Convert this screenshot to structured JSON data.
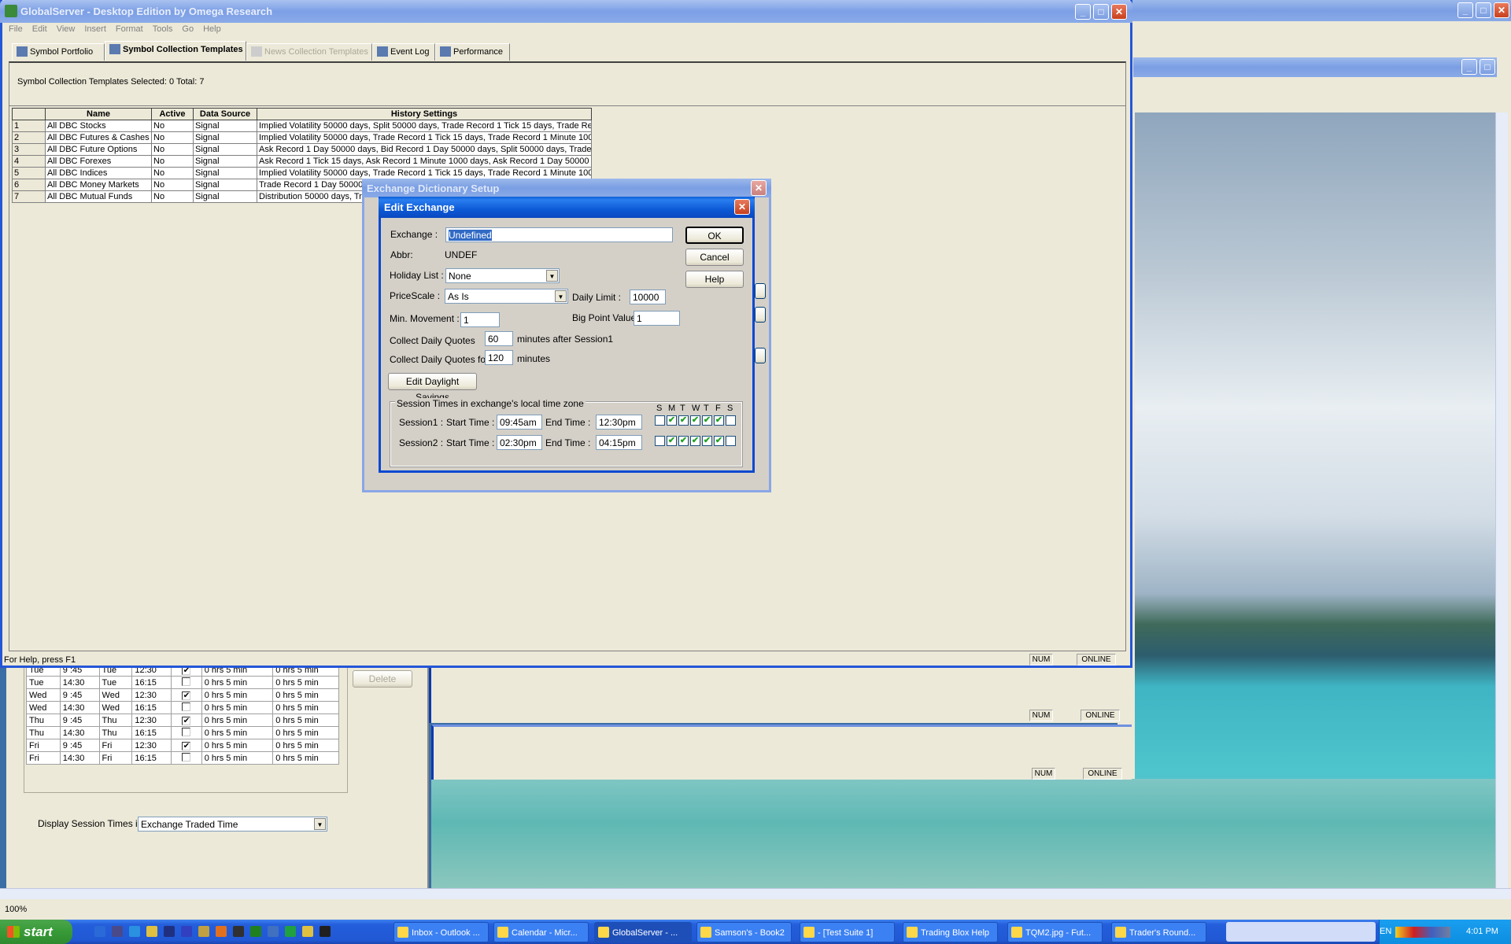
{
  "main_window": {
    "title": "GlobalServer - Desktop Edition by Omega Research",
    "menu": [
      "File",
      "Edit",
      "View",
      "Insert",
      "Format",
      "Tools",
      "Go",
      "Help"
    ],
    "tabs": [
      {
        "label": "Symbol Portfolio",
        "state": "normal"
      },
      {
        "label": "Symbol Collection Templates",
        "state": "active"
      },
      {
        "label": "News Collection Templates",
        "state": "disabled"
      },
      {
        "label": "Event Log",
        "state": "normal"
      },
      {
        "label": "Performance",
        "state": "normal"
      }
    ],
    "summary": "Symbol Collection Templates  Selected: 0   Total: 7",
    "table": {
      "columns": [
        "",
        "Name",
        "Active",
        "Data Source",
        "History Settings"
      ],
      "rows": [
        [
          "1",
          "All DBC Stocks",
          "No",
          "Signal",
          "Implied Volatility 50000 days, Split 50000 days, Trade Record 1 Tick 15 days, Trade Rec"
        ],
        [
          "2",
          "All DBC Futures & Cashes",
          "No",
          "Signal",
          "Implied Volatility 50000 days, Trade Record 1 Tick 15 days, Trade Record 1 Minute 1000"
        ],
        [
          "3",
          "All DBC Future Options",
          "No",
          "Signal",
          "Ask Record 1 Day 50000 days, Bid Record 1 Day 50000 days, Split 50000 days, Trade"
        ],
        [
          "4",
          "All DBC Forexes",
          "No",
          "Signal",
          "Ask Record 1 Tick 15 days, Ask Record 1 Minute 1000 days, Ask Record 1 Day 50000"
        ],
        [
          "5",
          "All DBC Indices",
          "No",
          "Signal",
          "Implied Volatility 50000 days, Trade Record 1 Tick 15 days, Trade Record 1 Minute 1000"
        ],
        [
          "6",
          "All DBC Money Markets",
          "No",
          "Signal",
          "Trade Record 1 Day 50000"
        ],
        [
          "7",
          "All DBC Mutual Funds",
          "No",
          "Signal",
          "Distribution 50000 days, Trad"
        ]
      ]
    },
    "status": {
      "help": "For Help, press F1",
      "num": "NUM",
      "online": "ONLINE"
    }
  },
  "dict_dialog": {
    "title": "Exchange Dictionary Setup"
  },
  "edit_dialog": {
    "title": "Edit Exchange",
    "exchange_label": "Exchange :",
    "exchange_value": "Undefined",
    "abbr_label": "Abbr:",
    "abbr_value": "UNDEF",
    "holiday_label": "Holiday List :",
    "holiday_value": "None",
    "pricescale_label": "PriceScale :",
    "pricescale_value": "As Is",
    "daily_limit_label": "Daily Limit :",
    "daily_limit_value": "10000",
    "min_move_label": "Min. Movement :",
    "min_move_value": "1",
    "bpv_label": "Big Point Value:",
    "bpv_value": "1",
    "cdq_label": "Collect Daily Quotes",
    "cdq_value": "60",
    "cdq_suffix": "minutes after Session1",
    "cdqf_label": "Collect Daily Quotes for",
    "cdqf_value": "120",
    "cdqf_suffix": "minutes",
    "dst_button": "Edit Daylight Savings",
    "ok": "OK",
    "cancel": "Cancel",
    "help": "Help",
    "group_label": "Session Times in exchange's local time zone",
    "days": [
      "S",
      "M",
      "T",
      "W",
      "T",
      "F",
      "S"
    ],
    "start_label": "Start Time :",
    "end_label": "End Time :",
    "sessions": [
      {
        "label": "Session1 :",
        "start": "09:45am",
        "end": "12:30pm",
        "days": [
          false,
          true,
          true,
          true,
          true,
          true,
          false
        ]
      },
      {
        "label": "Session2 :",
        "start": "02:30pm",
        "end": "04:15pm",
        "days": [
          false,
          true,
          true,
          true,
          true,
          true,
          false
        ]
      }
    ]
  },
  "back_window": {
    "schedule": [
      [
        "Tue",
        "9 :45",
        "Tue",
        "12:30",
        true,
        "0  hrs  5  min",
        "0  hrs  5  min"
      ],
      [
        "Tue",
        "14:30",
        "Tue",
        "16:15",
        false,
        "0  hrs  5  min",
        "0  hrs  5  min"
      ],
      [
        "Wed",
        "9 :45",
        "Wed",
        "12:30",
        true,
        "0  hrs  5  min",
        "0  hrs  5  min"
      ],
      [
        "Wed",
        "14:30",
        "Wed",
        "16:15",
        false,
        "0  hrs  5  min",
        "0  hrs  5  min"
      ],
      [
        "Thu",
        "9 :45",
        "Thu",
        "12:30",
        true,
        "0  hrs  5  min",
        "0  hrs  5  min"
      ],
      [
        "Thu",
        "14:30",
        "Thu",
        "16:15",
        false,
        "0  hrs  5  min",
        "0  hrs  5  min"
      ],
      [
        "Fri",
        "9 :45",
        "Fri",
        "12:30",
        true,
        "0  hrs  5  min",
        "0  hrs  5  min"
      ],
      [
        "Fri",
        "14:30",
        "Fri",
        "16:15",
        false,
        "0  hrs  5  min",
        "0  hrs  5  min"
      ]
    ],
    "delete_button": "Delete",
    "display_label": "Display Session Times in:",
    "display_value": "Exchange Traded Time"
  },
  "viewer": {
    "zoom": "100%"
  },
  "taskbar": {
    "start": "start",
    "tasks": [
      {
        "label": "Inbox - Outlook ...",
        "active": false
      },
      {
        "label": "Calendar - Micr...",
        "active": false
      },
      {
        "label": "GlobalServer - ...",
        "active": true
      },
      {
        "label": "Samson's - Book2",
        "active": false
      },
      {
        "label": "- [Test Suite 1]",
        "active": false
      },
      {
        "label": "Trading Blox Help",
        "active": false
      },
      {
        "label": "TQM2.jpg - Fut...",
        "active": false
      },
      {
        "label": "Trader's Round...",
        "active": false
      }
    ],
    "lang": "EN",
    "clock": "4:01 PM"
  },
  "colors": {
    "title_active": "#0a5fd8",
    "face": "#ece9d8",
    "taskbar": "#245edb",
    "start": "#3c9a3c"
  }
}
